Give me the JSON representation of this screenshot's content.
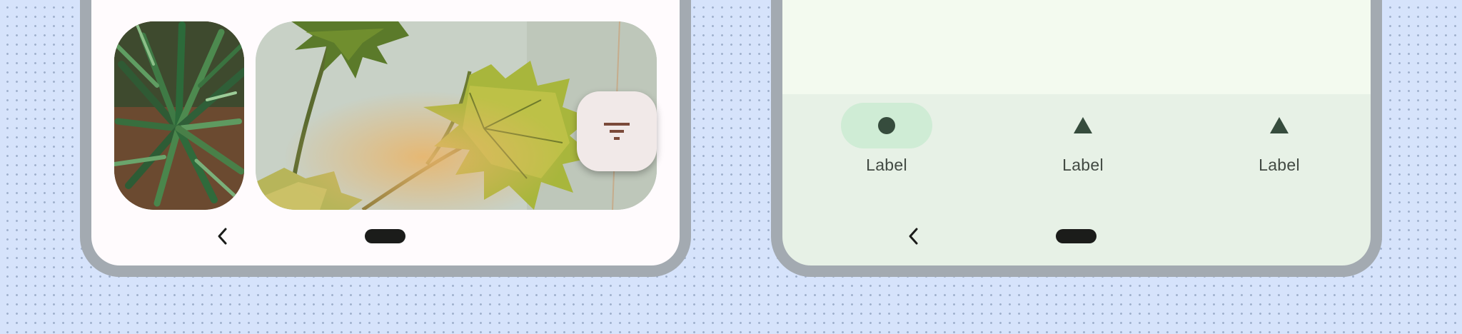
{
  "left_phone": {
    "fab": {
      "icon": "filter-list-icon"
    },
    "system_nav": {
      "back_icon": "chevron-left-icon",
      "home_icon": "home-pill-icon"
    }
  },
  "right_phone": {
    "navigation_bar": {
      "items": [
        {
          "label": "Label",
          "icon": "circle-icon",
          "selected": true
        },
        {
          "label": "Label",
          "icon": "triangle-icon",
          "selected": false
        },
        {
          "label": "Label",
          "icon": "triangle-icon",
          "selected": false
        }
      ]
    },
    "system_nav": {
      "back_icon": "chevron-left-icon",
      "home_icon": "home-pill-icon"
    }
  },
  "colors": {
    "background": "#d6e3fb",
    "frame": "#a3aab1",
    "left_surface": "#fffbfd",
    "right_surface": "#e7f1e6",
    "right_content": "#f3faef",
    "active_indicator": "#cfecd5",
    "icon": "#364c3d",
    "fab_surface": "#f1e9e8",
    "fab_icon": "#7b4a3a"
  }
}
